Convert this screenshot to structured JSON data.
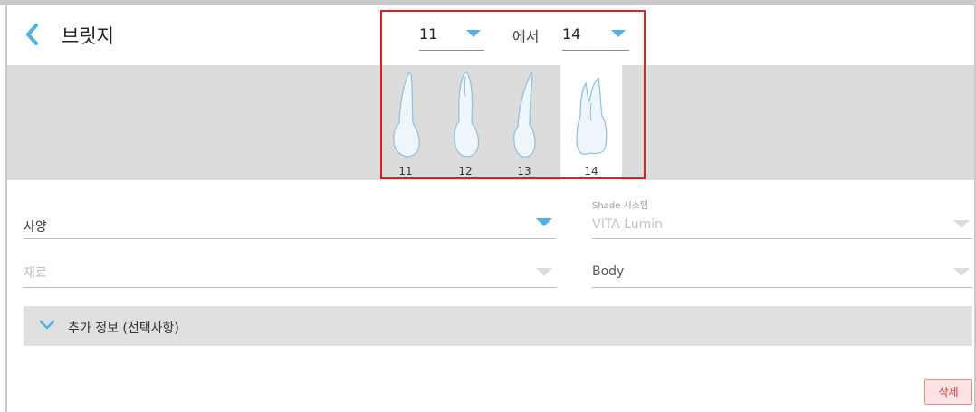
{
  "header": {
    "title": "브릿지",
    "range_from": "11",
    "range_connector": "에서",
    "range_to": "14"
  },
  "teeth": [
    {
      "number": "11",
      "selected": false
    },
    {
      "number": "12",
      "selected": false
    },
    {
      "number": "13",
      "selected": false
    },
    {
      "number": "14",
      "selected": true
    }
  ],
  "form": {
    "spec_label": "사양",
    "shade_system_label": "Shade 시스템",
    "shade_system_value": "VITA Lumin",
    "material_label": "재료",
    "body_label": "Body"
  },
  "extra_info": {
    "label": "추가 정보 (선택사항)"
  },
  "actions": {
    "delete_label": "삭제"
  },
  "colors": {
    "accent": "#4ab4e8",
    "highlight_border": "#e02020",
    "delete_bg": "#fde3e3",
    "delete_text": "#d03838"
  }
}
